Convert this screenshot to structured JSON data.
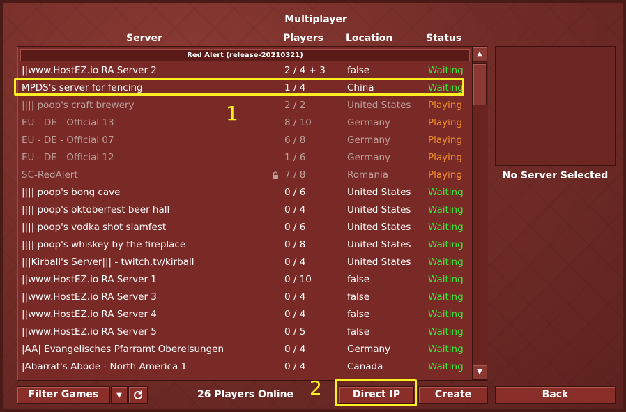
{
  "window": {
    "title": "Multiplayer"
  },
  "columns": {
    "server": "Server",
    "players": "Players",
    "location": "Location",
    "status": "Status"
  },
  "group_header": "Red Alert (release-20210321)",
  "servers": [
    {
      "name": "||www.HostEZ.io RA Server 2",
      "players": "2 / 4 + 3",
      "location": "false",
      "status": "Waiting",
      "style": "normal",
      "locked": false
    },
    {
      "name": "MPDS's server for fencing",
      "players": "1 / 4",
      "location": "China",
      "status": "Waiting",
      "style": "normal",
      "locked": false
    },
    {
      "name": "||||     poop's craft brewery",
      "players": "2 / 2",
      "location": "United States",
      "status": "Playing",
      "style": "dim",
      "locked": false
    },
    {
      "name": "EU - DE - Official 13",
      "players": "8 / 10",
      "location": "Germany",
      "status": "Playing",
      "style": "dim",
      "locked": false
    },
    {
      "name": "EU - DE - Official 07",
      "players": "6 / 8",
      "location": "Germany",
      "status": "Playing",
      "style": "dim",
      "locked": false
    },
    {
      "name": "EU - DE - Official 12",
      "players": "1 / 6",
      "location": "Germany",
      "status": "Playing",
      "style": "dim",
      "locked": false
    },
    {
      "name": "SC-RedAlert",
      "players": "7 / 8",
      "location": "Romania",
      "status": "Playing",
      "style": "dim",
      "locked": true
    },
    {
      "name": "||||     poop's bong cave",
      "players": "0 / 6",
      "location": "United States",
      "status": "Waiting",
      "style": "normal",
      "locked": false
    },
    {
      "name": "||||     poop's oktoberfest beer hall",
      "players": "0 / 4",
      "location": "United States",
      "status": "Waiting",
      "style": "normal",
      "locked": false
    },
    {
      "name": "||||     poop's vodka shot slamfest",
      "players": "0 / 6",
      "location": "United States",
      "status": "Waiting",
      "style": "normal",
      "locked": false
    },
    {
      "name": "||||     poop's whiskey by the fireplace",
      "players": "0 / 8",
      "location": "United States",
      "status": "Waiting",
      "style": "normal",
      "locked": false
    },
    {
      "name": "|||Kirball's Server||| - twitch.tv/kirball",
      "players": "0 / 4",
      "location": "United States",
      "status": "Waiting",
      "style": "normal",
      "locked": false
    },
    {
      "name": "||www.HostEZ.io RA Server 1",
      "players": "0 / 10",
      "location": "false",
      "status": "Waiting",
      "style": "normal",
      "locked": false
    },
    {
      "name": "||www.HostEZ.io RA Server 3",
      "players": "0 / 4",
      "location": "false",
      "status": "Waiting",
      "style": "normal",
      "locked": false
    },
    {
      "name": "||www.HostEZ.io RA Server 4",
      "players": "0 / 4",
      "location": "false",
      "status": "Waiting",
      "style": "normal",
      "locked": false
    },
    {
      "name": "||www.HostEZ.io RA Server 5",
      "players": "0 / 5",
      "location": "false",
      "status": "Waiting",
      "style": "normal",
      "locked": false
    },
    {
      "name": "|AA| Evangelisches Pfarramt Oberelsungen",
      "players": "0 / 4",
      "location": "Germany",
      "status": "Waiting",
      "style": "normal",
      "locked": false
    },
    {
      "name": "|Abarrat's Abode - North America 1",
      "players": "0 / 4",
      "location": "Canada",
      "status": "Waiting",
      "style": "normal",
      "locked": false
    }
  ],
  "preview": {
    "no_server_text": "No Server Selected"
  },
  "footer": {
    "filter_label": "Filter Games",
    "players_online": "26 Players Online",
    "direct_ip_label": "Direct IP",
    "create_label": "Create",
    "back_label": "Back"
  },
  "annotations": {
    "marker_1": "1",
    "marker_2": "2"
  },
  "colors": {
    "waiting": "#3ce63c",
    "playing": "#f0902c",
    "annotation": "#ffee22"
  },
  "icons": {
    "scroll_up": "triangle-up-icon",
    "scroll_down": "triangle-down-icon",
    "dropdown": "triangle-down-icon",
    "refresh": "refresh-icon",
    "lock": "lock-icon"
  }
}
